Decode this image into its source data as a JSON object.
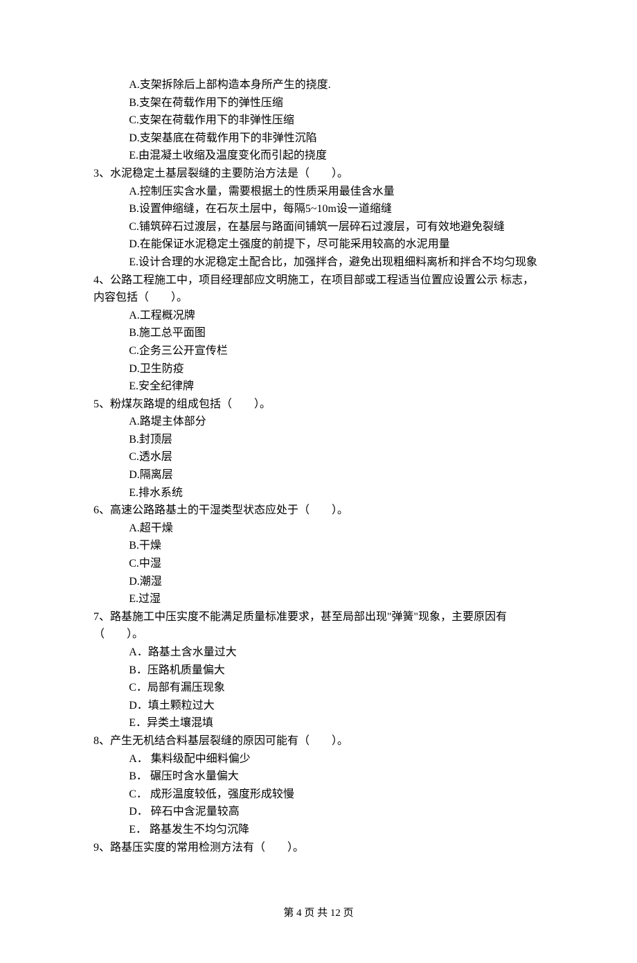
{
  "pre_options": [
    "A.支架拆除后上部构造本身所产生的挠度.",
    "B.支架在荷载作用下的弹性压缩",
    "C.支架在荷载作用下的非弹性压缩",
    "D.支架基底在荷载作用下的非弹性沉陷",
    "E.由混凝土收缩及温度变化而引起的挠度"
  ],
  "questions": [
    {
      "stem": "3、水泥稳定土基层裂缝的主要防治方法是（　　）。",
      "options": [
        "A.控制压实含水量，需要根据土的性质采用最佳含水量",
        "B.设置伸缩缝，在石灰土层中，每隔5~10m设一道缩缝",
        "C.铺筑碎石过渡层，在基层与路面间铺筑一层碎石过渡层，可有效地避免裂缝",
        "D.在能保证水泥稳定土强度的前提下，尽可能采用较高的水泥用量",
        "E.设计合理的水泥稳定土配合比，加强拌合，避免出现粗细料离析和拌合不均匀现象"
      ]
    },
    {
      "stem": "4、公路工程施工中，项目经理部应文明施工，在项目部或工程适当位置应设置公示 标志，",
      "stem2": "内容包括（　　）。",
      "options": [
        "A.工程概况牌",
        "B.施工总平面图",
        "C.企务三公开宣传栏",
        "D.卫生防疫",
        "E.安全纪律牌"
      ]
    },
    {
      "stem": "5、粉煤灰路堤的组成包括（　　）。",
      "options": [
        "A.路堤主体部分",
        "B.封顶层",
        "C.透水层",
        "D.隔离层",
        "E.排水系统"
      ]
    },
    {
      "stem": "6、高速公路路基土的干湿类型状态应处于（　　）。",
      "options": [
        "A.超干燥",
        "B.干燥",
        "C.中湿",
        "D.潮湿",
        "E.过湿"
      ]
    },
    {
      "stem": "7、路基施工中压实度不能满足质量标准要求，甚至局部出现\"弹簧\"现象，主要原因有",
      "stem2": "（　　）。",
      "options": [
        "A．路基土含水量过大",
        "B．压路机质量偏大",
        "C．局部有漏压现象",
        "D．填土颗粒过大",
        "E．异类土壤混填"
      ]
    },
    {
      "stem": "8、产生无机结合料基层裂缝的原因可能有（　　）。",
      "options": [
        "A． 集料级配中细料偏少",
        "B． 碾压时含水量偏大",
        "C． 成形温度较低，强度形成较慢",
        "D． 碎石中含泥量较高",
        "E． 路基发生不均匀沉降"
      ]
    },
    {
      "stem": "9、路基压实度的常用检测方法有（　　）。",
      "options": []
    }
  ],
  "footer": {
    "prefix": "第 ",
    "current": "4",
    "middle": " 页 共 ",
    "total": "12",
    "suffix": " 页"
  }
}
